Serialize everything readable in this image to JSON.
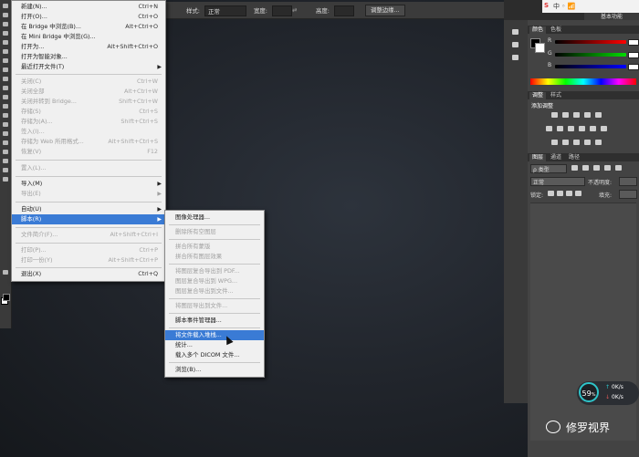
{
  "option_bar": {
    "style_label": "样式:",
    "style_value": "正常",
    "width_label": "宽度:",
    "height_label": "高度:",
    "refine_edge": "调整边缘..."
  },
  "essentials": "基本功能",
  "tray_text": "中 ◦ 📶",
  "file_menu": {
    "items": [
      {
        "label": "新建(N)...",
        "shortcut": "Ctrl+N",
        "disabled": false
      },
      {
        "label": "打开(O)...",
        "shortcut": "Ctrl+O",
        "disabled": false
      },
      {
        "label": "在 Bridge 中浏览(B)...",
        "shortcut": "Alt+Ctrl+O",
        "disabled": false
      },
      {
        "label": "在 Mini Bridge 中浏览(G)...",
        "shortcut": "",
        "disabled": false
      },
      {
        "label": "打开为...",
        "shortcut": "Alt+Shift+Ctrl+O",
        "disabled": false
      },
      {
        "label": "打开为智能对象...",
        "shortcut": "",
        "disabled": false
      },
      {
        "label": "最近打开文件(T)",
        "shortcut": "",
        "disabled": false,
        "submenu": true
      },
      {
        "label": "关闭(C)",
        "shortcut": "Ctrl+W",
        "disabled": true
      },
      {
        "label": "关闭全部",
        "shortcut": "Alt+Ctrl+W",
        "disabled": true
      },
      {
        "label": "关闭并转到 Bridge...",
        "shortcut": "Shift+Ctrl+W",
        "disabled": true
      },
      {
        "label": "存储(S)",
        "shortcut": "Ctrl+S",
        "disabled": true
      },
      {
        "label": "存储为(A)...",
        "shortcut": "Shift+Ctrl+S",
        "disabled": true
      },
      {
        "label": "签入(I)...",
        "shortcut": "",
        "disabled": true
      },
      {
        "label": "存储为 Web 所用格式...",
        "shortcut": "Alt+Shift+Ctrl+S",
        "disabled": true
      },
      {
        "label": "恢复(V)",
        "shortcut": "F12",
        "disabled": true
      },
      {
        "label": "置入(L)...",
        "shortcut": "",
        "disabled": true
      },
      {
        "label": "导入(M)",
        "shortcut": "",
        "disabled": false,
        "submenu": true
      },
      {
        "label": "导出(E)",
        "shortcut": "",
        "disabled": true,
        "submenu": true
      },
      {
        "label": "自动(U)",
        "shortcut": "",
        "disabled": false,
        "submenu": true
      },
      {
        "label": "脚本(R)",
        "shortcut": "",
        "disabled": false,
        "submenu": true,
        "highlight": true
      },
      {
        "label": "文件简介(F)...",
        "shortcut": "Alt+Shift+Ctrl+I",
        "disabled": true
      },
      {
        "label": "打印(P)...",
        "shortcut": "Ctrl+P",
        "disabled": true
      },
      {
        "label": "打印一份(Y)",
        "shortcut": "Alt+Shift+Ctrl+P",
        "disabled": true
      },
      {
        "label": "退出(X)",
        "shortcut": "Ctrl+Q",
        "disabled": false
      }
    ]
  },
  "scripts_submenu": {
    "items": [
      {
        "label": "图像处理器...",
        "disabled": false
      },
      {
        "label": "删除所有空图层",
        "disabled": true
      },
      {
        "label": "拼合所有蒙版",
        "disabled": true
      },
      {
        "label": "拼合所有图层效果",
        "disabled": true
      },
      {
        "label": "将图层复合导出到 PDF...",
        "disabled": true
      },
      {
        "label": "图层复合导出到 WPG...",
        "disabled": true
      },
      {
        "label": "图层复合导出到文件...",
        "disabled": true
      },
      {
        "label": "将图层导出到文件...",
        "disabled": true
      },
      {
        "label": "脚本事件管理器...",
        "disabled": false
      },
      {
        "label": "将文件载入堆栈...",
        "disabled": false,
        "highlight": true
      },
      {
        "label": "统计...",
        "disabled": false
      },
      {
        "label": "载入多个 DICOM 文件...",
        "disabled": false
      },
      {
        "label": "浏览(B)...",
        "disabled": false
      }
    ]
  },
  "panels": {
    "color_tabs": [
      "颜色",
      "色板"
    ],
    "channels": [
      "R",
      "G",
      "B"
    ],
    "channel_values": [
      "",
      "",
      ""
    ],
    "adjust_tabs": [
      "调整",
      "样式"
    ],
    "adjust_title": "添加调整",
    "layers_tabs": [
      "图层",
      "通道",
      "路径"
    ],
    "kind_label": "ρ 类型",
    "blend_mode": "正常",
    "opacity_label": "不透明度:",
    "lock_label": "锁定:",
    "fill_label": "填充:"
  },
  "widget": {
    "percent": "59",
    "percent_unit": "%",
    "up_speed": "0K/s",
    "down_speed": "0K/s"
  },
  "watermark": "修罗视界"
}
